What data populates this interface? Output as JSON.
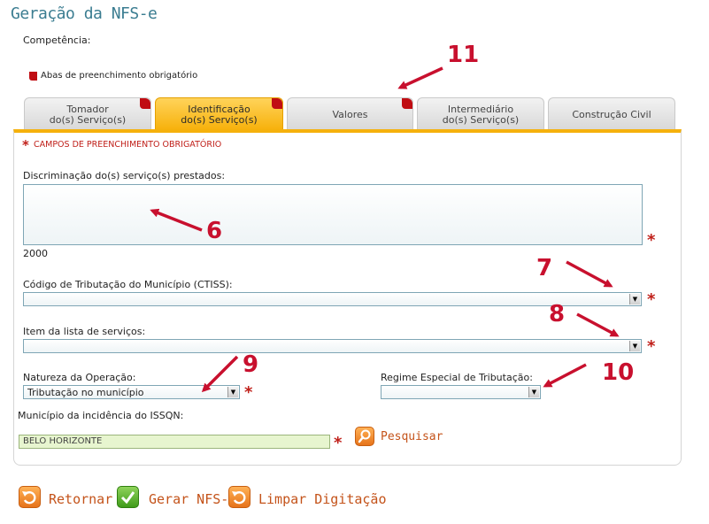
{
  "page": {
    "title": "Geração da NFS-e",
    "competencia_label": "Competência:",
    "legend": "Abas de preenchimento obrigatório"
  },
  "tabs": [
    {
      "line1": "Tomador",
      "line2": "do(s) Serviço(s)",
      "required": true,
      "active": false
    },
    {
      "line1": "Identificação",
      "line2": "do(s) Serviço(s)",
      "required": true,
      "active": true
    },
    {
      "line1": "Valores",
      "line2": "",
      "required": true,
      "active": false
    },
    {
      "line1": "Intermediário",
      "line2": "do(s) Serviço(s)",
      "required": false,
      "active": false
    },
    {
      "line1": "Construção Civil",
      "line2": "",
      "required": false,
      "active": false
    }
  ],
  "form": {
    "required_note": "CAMPOS DE PREENCHIMENTO OBRIGATÓRIO",
    "discriminacao_label": "Discriminação do(s) serviço(s) prestados:",
    "discriminacao_value": "",
    "char_counter": "2000",
    "ctiss_label": "Código de Tributação do Município (CTISS):",
    "ctiss_value": "",
    "item_lista_label": "Item da lista de serviços:",
    "item_lista_value": "",
    "natureza_label": "Natureza da Operação:",
    "natureza_value": "Tributação no município",
    "regime_label": "Regime Especial de Tributação:",
    "regime_value": "",
    "municipio_label": "Município da incidência do ISSQN:",
    "municipio_value": "BELO HORIZONTE",
    "pesquisar_label": "Pesquisar",
    "required_star": "*"
  },
  "actions": {
    "retornar": "Retornar",
    "gerar": "Gerar NFS-e",
    "limpar": "Limpar Digitação"
  },
  "annotations": [
    "6",
    "7",
    "8",
    "9",
    "10",
    "11"
  ],
  "colors": {
    "accent": "#f5b10c",
    "title": "#3b7d91",
    "required": "#c00d13",
    "annotation": "#c8102e"
  }
}
